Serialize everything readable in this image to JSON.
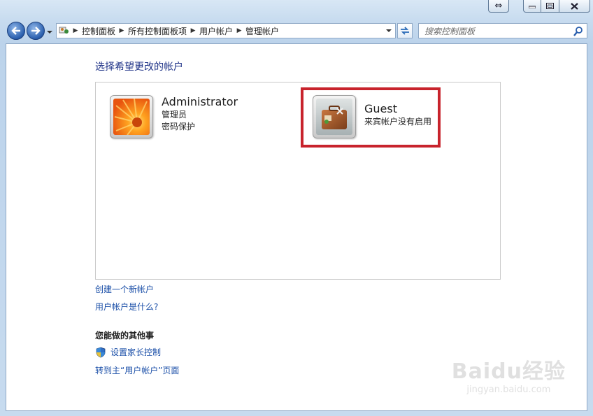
{
  "window": {
    "caption_back_glyph": "⇔"
  },
  "navbar": {
    "breadcrumbs": [
      "控制面板",
      "所有控制面板项",
      "用户帐户",
      "管理帐户"
    ],
    "search_placeholder": "搜索控制面板"
  },
  "main": {
    "heading": "选择希望更改的帐户",
    "accounts": [
      {
        "name": "Administrator",
        "lines": [
          "管理员",
          "密码保护"
        ],
        "icon": "flower-avatar-icon"
      },
      {
        "name": "Guest",
        "lines": [
          "来宾帐户没有启用"
        ],
        "icon": "briefcase-avatar-icon"
      }
    ],
    "links": {
      "create_account": "创建一个新帐户",
      "what_is_account": "用户帐户是什么?"
    },
    "other_heading": "您能做的其他事",
    "other_links": {
      "parental_control": "设置家长控制",
      "goto_main": "转到主“用户帐户”页面"
    }
  },
  "watermark": {
    "logo": "Baidu经验",
    "url": "jingyan.baidu.com"
  },
  "colors": {
    "link": "#1b4fa8",
    "heading": "#1e3287",
    "highlight": "#c8232c"
  }
}
